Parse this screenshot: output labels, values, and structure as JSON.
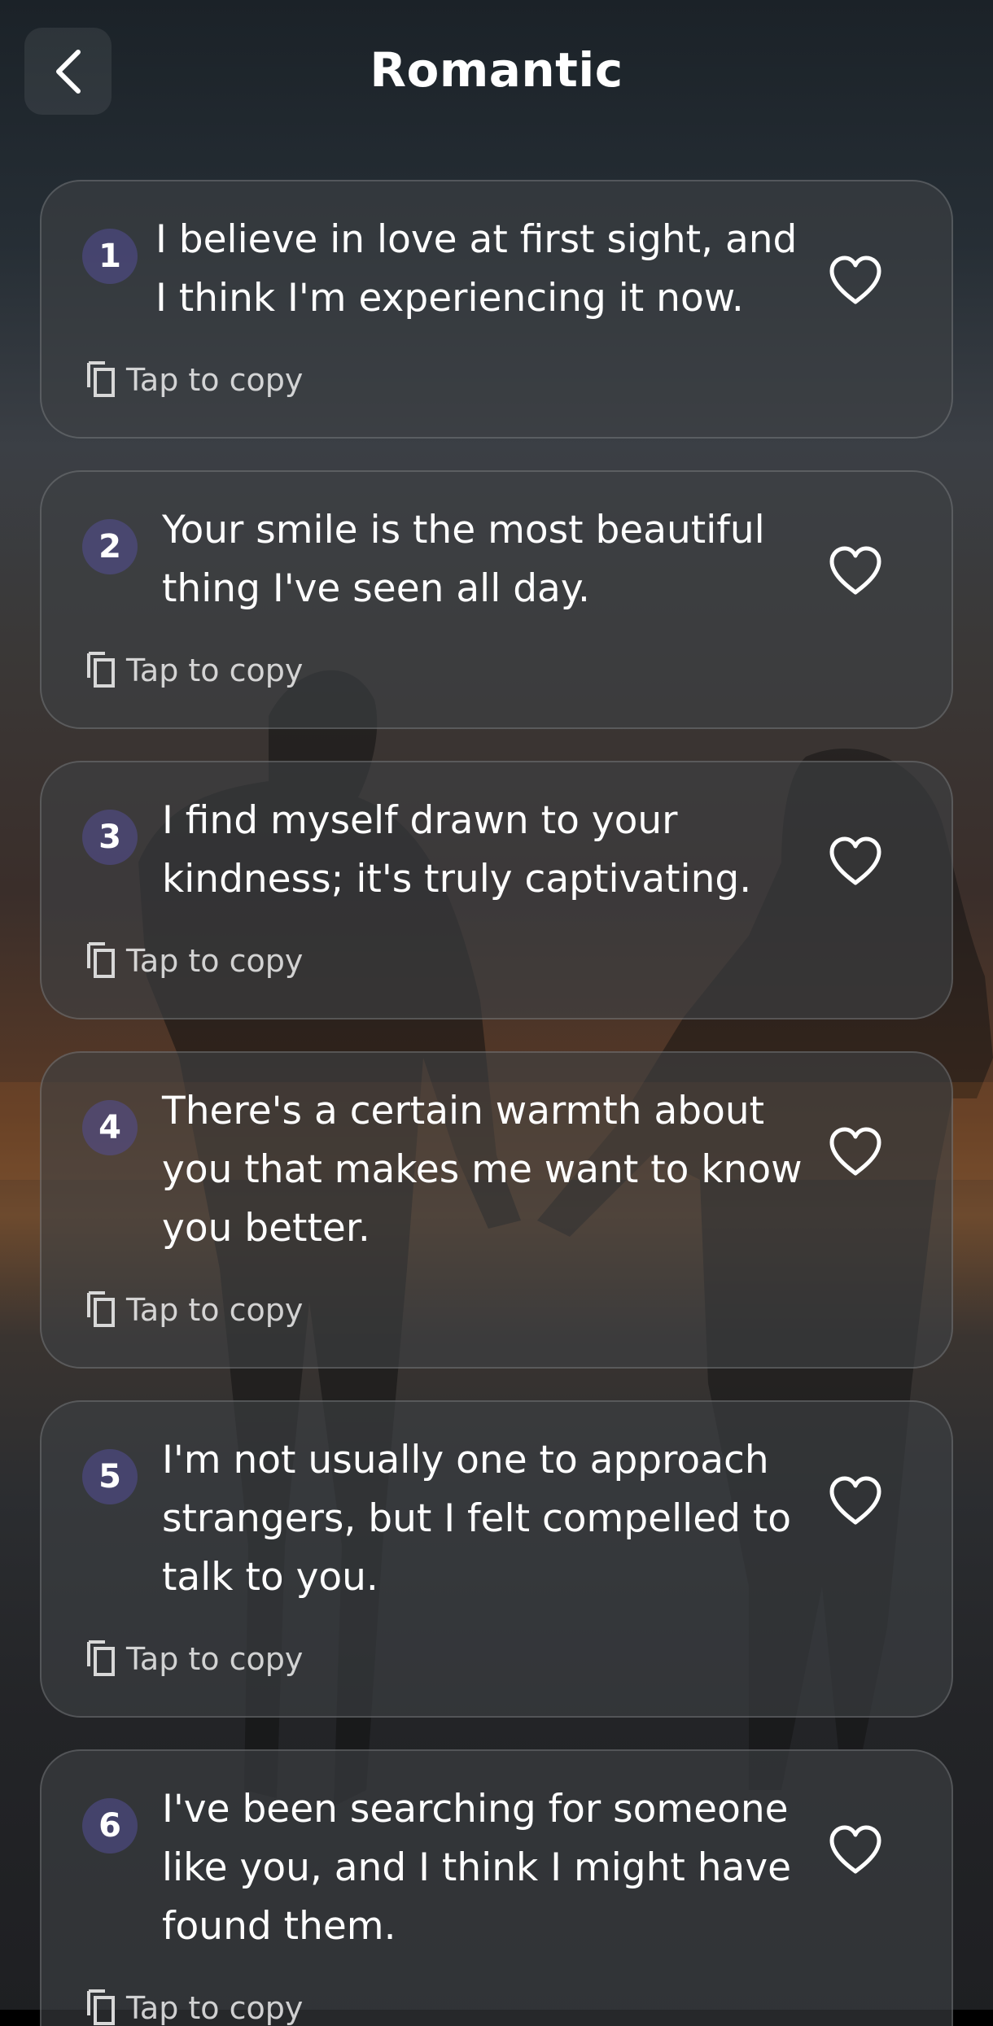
{
  "header": {
    "title": "Romantic",
    "back_icon": "chevron-left-icon"
  },
  "icons": {
    "favorite": "heart-outline-icon",
    "copy": "copy-icon"
  },
  "copy_label": "Tap to copy",
  "quotes": [
    {
      "number": "1",
      "lines": [
        "I believe in love at first sight, and",
        "I think I'm experiencing it now."
      ]
    },
    {
      "number": "2",
      "lines": [
        "Your smile is the most beautiful",
        "thing I've seen all day."
      ]
    },
    {
      "number": "3",
      "lines": [
        "I find myself drawn to your",
        "kindness; it's truly captivating."
      ]
    },
    {
      "number": "4",
      "lines": [
        "There's a certain warmth about",
        "you that makes me want to know",
        "you better."
      ]
    },
    {
      "number": "5",
      "lines": [
        "I'm not usually one to approach",
        "strangers, but I felt compelled to",
        "talk to you."
      ]
    },
    {
      "number": "6",
      "lines": [
        "I've been searching for someone",
        "like you, and I think I might have",
        "found them."
      ]
    }
  ],
  "colors": {
    "card_bg": "#3e4044",
    "number_badge": "#544e96",
    "text": "#ffffff"
  }
}
